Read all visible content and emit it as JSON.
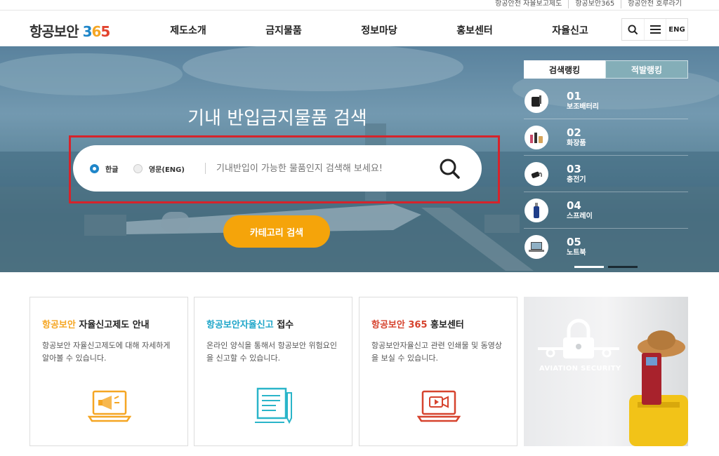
{
  "util_links": [
    "항공안전 자율보고제도",
    "항공보안365",
    "항공안전 호루라기"
  ],
  "header": {
    "logo_text": "항공보안",
    "logo_digits": [
      "3",
      "6",
      "5"
    ],
    "nav": [
      "제도소개",
      "금지물품",
      "정보마당",
      "홍보센터",
      "자율신고"
    ],
    "lang_label": "ENG",
    "icons": [
      "search-icon",
      "menu-icon"
    ]
  },
  "hero": {
    "title": "기내 반입금지물품 검색",
    "radio_korean": "한글",
    "radio_english": "영문(ENG)",
    "radio_selected": "한글",
    "search_placeholder": "기내반입이 가능한 물품인지 검색해 보세요!",
    "category_button": "카테고리 검색"
  },
  "ranking": {
    "tabs": [
      "검색랭킹",
      "적발랭킹"
    ],
    "active_tab": "검색랭킹",
    "items": [
      {
        "rank": "01",
        "name": "보조배터리",
        "icon": "power-bank-icon"
      },
      {
        "rank": "02",
        "name": "화장품",
        "icon": "cosmetics-icon"
      },
      {
        "rank": "03",
        "name": "충전기",
        "icon": "charger-icon"
      },
      {
        "rank": "04",
        "name": "스프레이",
        "icon": "spray-icon"
      },
      {
        "rank": "05",
        "name": "노트북",
        "icon": "laptop-icon"
      }
    ],
    "page_count": 2,
    "active_page": 2
  },
  "cards": [
    {
      "title_hl": "항공보안",
      "title_rest": " 자율신고제도 안내",
      "desc": "항공보안 자율신고제도에 대해 자세하게 알아볼 수 있습니다.",
      "icon": "megaphone-laptop-icon"
    },
    {
      "title_hl": "항공보안자율신고",
      "title_rest": " 접수",
      "desc": "온라인 양식을 통해서 항공보안 위험요인을 신고할 수 있습니다.",
      "icon": "document-pen-icon"
    },
    {
      "title_hl": "항공보안 365",
      "title_rest": " 홍보센터",
      "desc": "항공보안자율신고 관련 인쇄물 및 동영상을 보실 수 있습니다.",
      "icon": "video-laptop-icon"
    }
  ],
  "promo": {
    "label": "AVIATION SECURITY"
  },
  "colors": {
    "brand_blue": "#1f86c9",
    "accent_orange": "#f5a40a",
    "highlight_red": "#d6232b"
  }
}
